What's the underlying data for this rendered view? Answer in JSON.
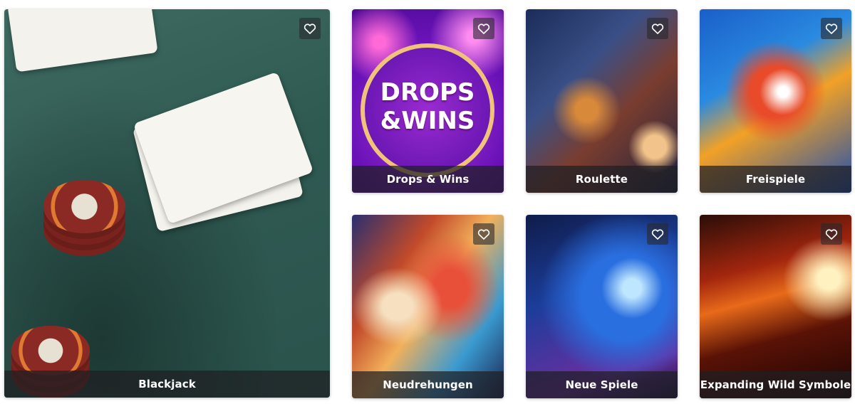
{
  "tiles": [
    {
      "id": "blackjack",
      "label": "Blackjack"
    },
    {
      "id": "drops",
      "label": "Drops & Wins"
    },
    {
      "id": "roulette",
      "label": "Roulette"
    },
    {
      "id": "freispiele",
      "label": "Freispiele"
    },
    {
      "id": "neudrehungen",
      "label": "Neudrehungen"
    },
    {
      "id": "neue-spiele",
      "label": "Neue Spiele"
    },
    {
      "id": "expanding",
      "label": "Expanding Wild Symbole"
    }
  ],
  "promo": {
    "line1": "DROPS",
    "line2": "&WINS"
  },
  "icons": {
    "favorite": "heart-outline-icon"
  },
  "colors": {
    "label_bg": "#1e1e23",
    "label_text": "#ffffff"
  }
}
